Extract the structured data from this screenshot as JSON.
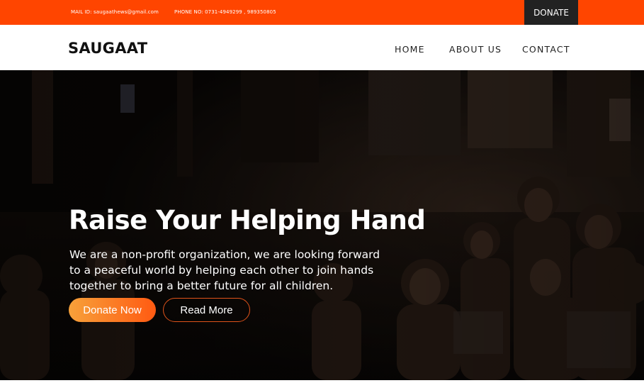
{
  "topbar": {
    "mail": "MAIL ID: saugaathews@gmail.com",
    "phone": "PHONE NO: 0731-4949299 , 989350805",
    "donate_label": "DONATE"
  },
  "navbar": {
    "brand": "SAUGAAT",
    "links": [
      "HOME",
      "ABOUT US",
      "CONTACT"
    ]
  },
  "hero": {
    "title": "Raise Your Helping Hand",
    "text": "We are a non-profit organization, we are looking forward to a peaceful world by helping each other to join hands together to bring a better future for all children.",
    "primary_button": "Donate Now",
    "secondary_button": "Read More"
  },
  "colors": {
    "accent": "#ff4500",
    "dark": "#222222",
    "gradient_start": "#f7a13a",
    "gradient_end": "#ff5a12"
  }
}
